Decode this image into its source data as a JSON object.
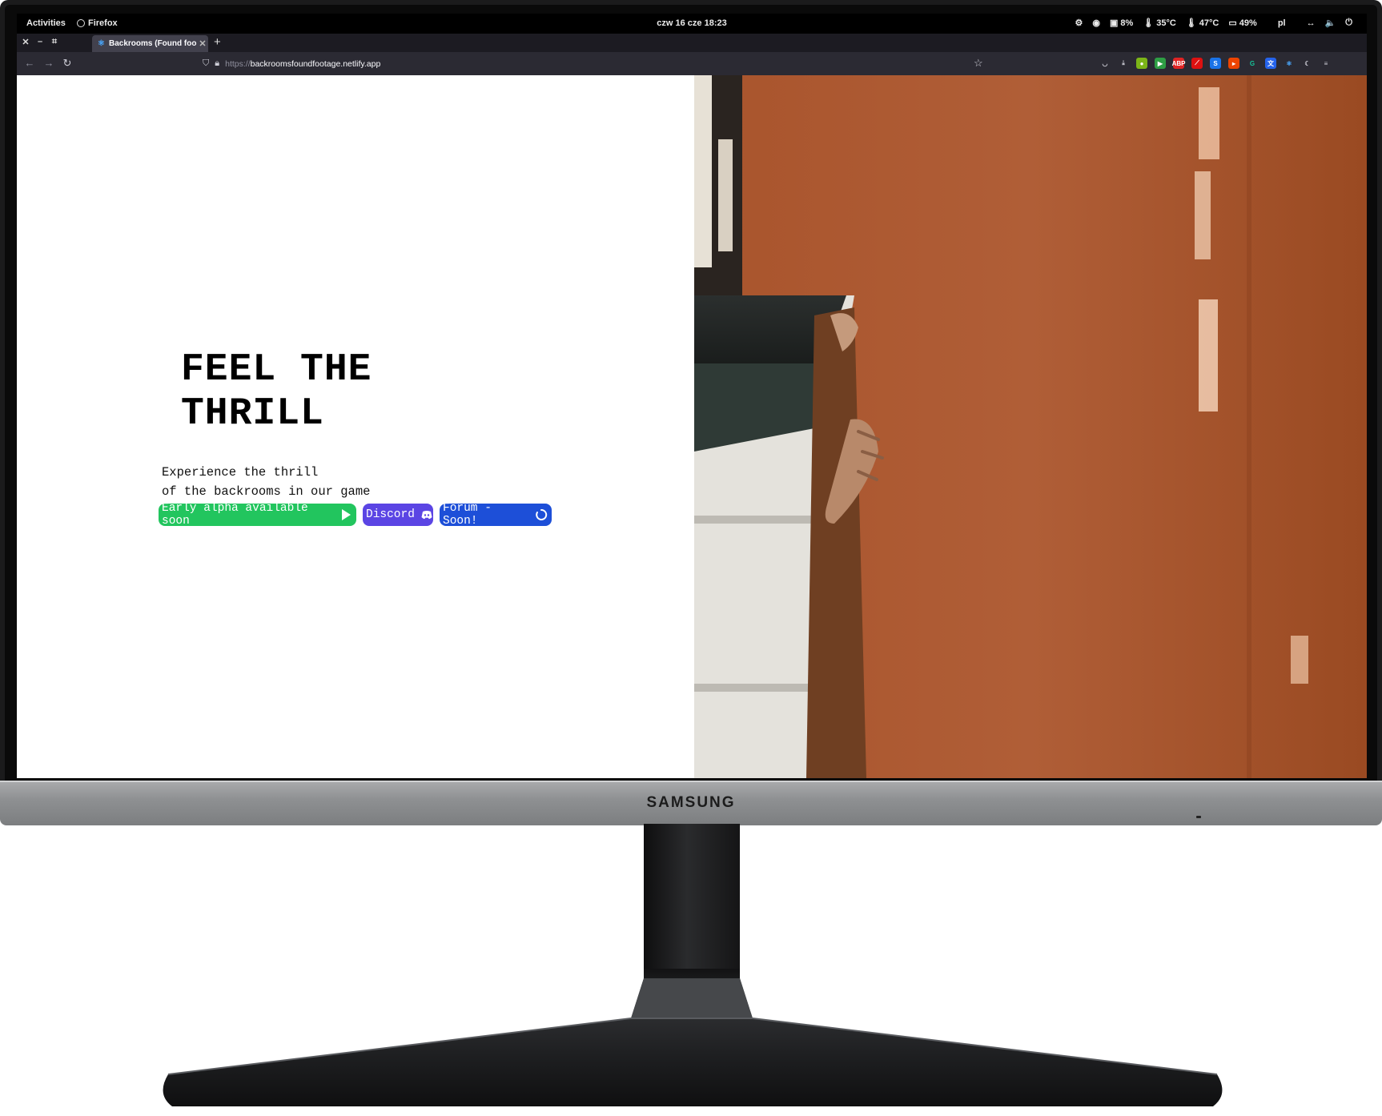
{
  "device": {
    "brand": "SAMSUNG"
  },
  "topbar": {
    "activities": "Activities",
    "app_name": "Firefox",
    "clock": "czw 16 cze  18:23",
    "status": {
      "storage": "8%",
      "temp_cpu": "35°C",
      "temp_gpu": "47°C",
      "battery": "49%",
      "keyboard_layout": "pl"
    }
  },
  "browser": {
    "tab_title": "Backrooms (Found foo",
    "new_tab_label": "+",
    "url_protocol": "https://",
    "url_domain": "backroomsfoundfootage.netlify.app"
  },
  "page": {
    "headline_line1": "FEEL THE",
    "headline_line2": "THRILL",
    "description_line1": "Experience the thrill",
    "description_line2": "of the backrooms in our game",
    "buttons": {
      "early_alpha": "Early alpha available soon",
      "discord": "Discord",
      "forum": "Forum - Soon!"
    }
  },
  "colors": {
    "green": "#22c55e",
    "purple": "#5b45e4",
    "blue": "#1d4fd8",
    "door": "#a5552c"
  }
}
